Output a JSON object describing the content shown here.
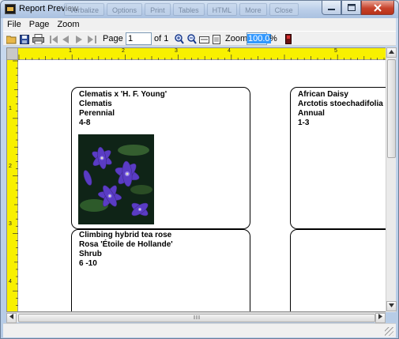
{
  "window": {
    "title": "Report Preview"
  },
  "background_taskbar": [
    "Verbalize",
    "Options",
    "Print",
    "Tables",
    "HTML",
    "More",
    "Close"
  ],
  "menu": [
    "File",
    "Page",
    "Zoom"
  ],
  "toolbar": {
    "page_label": "Page",
    "page_value": "1",
    "of_label": "of 1",
    "zoom_label": "Zoom",
    "zoom_value": "100.0",
    "percent": "%"
  },
  "ruler": {
    "top_numbers": [
      "1",
      "2",
      "3",
      "4",
      "5"
    ],
    "left_numbers": [
      "1",
      "2",
      "3",
      "4"
    ]
  },
  "cards": [
    {
      "lines": [
        "Clematis x 'H. F. Young'",
        "Clematis",
        "Perennial",
        "4-8"
      ],
      "has_photo": true
    },
    {
      "lines": [
        "African  Daisy",
        "Arctotis  stoechadifolia",
        "Annual",
        "1-3"
      ],
      "has_photo": false
    },
    {
      "lines": [
        "Climbing hybrid tea rose",
        "Rosa 'Étoile de Hollande'",
        "Shrub",
        "6  -10"
      ],
      "has_photo": false
    }
  ],
  "colors": {
    "ruler": "#f8f000",
    "zoom_highlight": "#3399ff",
    "close_button": "#c7432c"
  }
}
